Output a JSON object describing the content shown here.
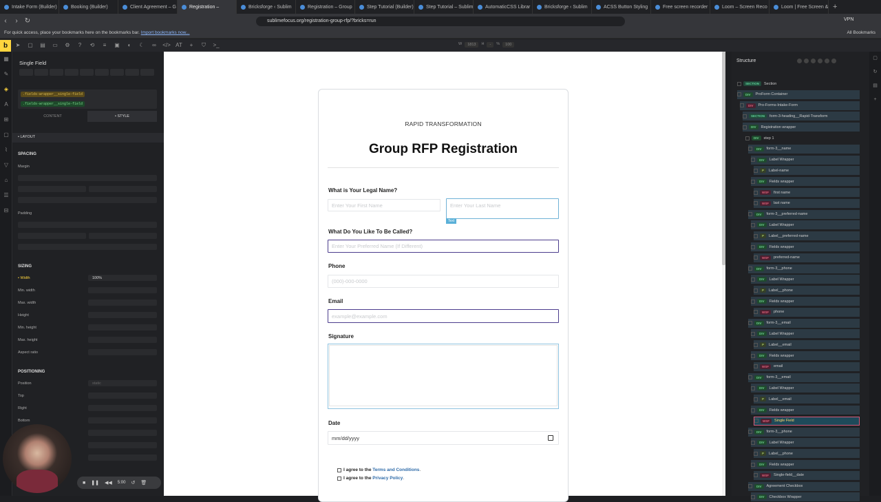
{
  "browser": {
    "tabs": [
      {
        "label": "Intake Form (Builder)",
        "active": false
      },
      {
        "label": "Booking (Builder)",
        "active": false
      },
      {
        "label": "Client Agreement – G",
        "active": false
      },
      {
        "label": "Registration –",
        "active": true
      },
      {
        "label": "Bricksforge ‹ Sublim",
        "active": false
      },
      {
        "label": "Registration – Group",
        "active": false
      },
      {
        "label": "Step Tutorial (Builder)",
        "active": false
      },
      {
        "label": "Step Tutorial – Sublim",
        "active": false
      },
      {
        "label": "AutomaticCSS Librar",
        "active": false
      },
      {
        "label": "Bricksforge ‹ Sublim",
        "active": false
      },
      {
        "label": "ACSS Button Styling",
        "active": false
      },
      {
        "label": "Free screen recorder",
        "active": false
      },
      {
        "label": "Loom – Screen Reco",
        "active": false
      },
      {
        "label": "Loom | Free Screen &",
        "active": false
      }
    ],
    "new_tab": "+",
    "url": "sublimefocus.org/registration-group-rfp/?bricks=run",
    "vpn": "VPN",
    "bookmarks_text": "For quick access, place your bookmarks here on the bookmarks bar.",
    "bookmarks_link": "Import bookmarks now...",
    "all_bookmarks": "All Bookmarks"
  },
  "builder": {
    "logo": "b",
    "toolbar_text_at": "AT",
    "dims": {
      "w_label": "W",
      "w_value": "1813",
      "h_label": "H",
      "h_value": "-",
      "pct_label": "%",
      "pct_value": "100"
    }
  },
  "panel": {
    "title": "Single Field",
    "class1": ".fields-wrapper__single-field",
    "class2": ".fields-wrapper__single-field",
    "tab_content": "CONTENT",
    "tab_style": "• STYLE",
    "layout": "• LAYOUT",
    "spacing": "SPACING",
    "margin": "Margin",
    "padding": "Padding",
    "sizing": "SIZING",
    "width_label": "• Width",
    "width_value": "100%",
    "min_width": "Min. width",
    "max_width": "Max. width",
    "height": "Height",
    "min_height": "Min. height",
    "max_height": "Max. height",
    "aspect_ratio": "Aspect ratio",
    "positioning": "POSITIONING",
    "position": "Position",
    "position_value": "static",
    "top": "Top",
    "right": "Right",
    "bottom": "Bottom"
  },
  "form": {
    "eyebrow": "RAPID TRANSFORMATION",
    "title": "Group RFP Registration",
    "q_name": "What is Your Legal Name?",
    "first_placeholder": "Enter Your First Name",
    "last_placeholder": "Enter Your Last Name",
    "text_tag": "Text",
    "q_called": "What Do You Like To Be Called?",
    "preferred_placeholder": "Enter Your Preferred Name (If Different)",
    "q_phone": "Phone",
    "phone_placeholder": "(000)-000-0000",
    "q_email": "Email",
    "email_placeholder": "example@example.com",
    "q_signature": "Signature",
    "q_date": "Date",
    "date_placeholder": "mm/dd/yyyy",
    "agree_prefix": "I agree to the",
    "terms": "Terms and Conditions",
    "privacy": "Privacy Policy"
  },
  "structure": {
    "title": "Structure",
    "rows": [
      {
        "tag": "SECTION",
        "label": "Section",
        "indent": 2,
        "style": "section"
      },
      {
        "tag": "DIV",
        "label": "ProForm Container",
        "indent": 2,
        "style": "div",
        "hl": true
      },
      {
        "tag": "DIV",
        "label": "Pro-Forms-Intake-Form",
        "indent": 3,
        "style": "wsf",
        "hl": true
      },
      {
        "tag": "SECTION",
        "label": "form-3-heading__Rapid-Transform",
        "indent": 4,
        "style": "section",
        "hl": true
      },
      {
        "tag": "DIV",
        "label": "Registration wrapper",
        "indent": 4,
        "style": "div",
        "hl": true
      },
      {
        "tag": "DIV",
        "label": "step 1",
        "indent": 5,
        "style": "div"
      },
      {
        "tag": "DIV",
        "label": "form-3__name",
        "indent": 6,
        "style": "div",
        "hl": true
      },
      {
        "tag": "DIV",
        "label": "Label Wrapper",
        "indent": 7,
        "style": "div",
        "hl": true
      },
      {
        "tag": "P",
        "label": "Label-name",
        "indent": 8,
        "style": "p",
        "hl": true
      },
      {
        "tag": "DIV",
        "label": "Fields wrapper",
        "indent": 7,
        "style": "div",
        "hl": true
      },
      {
        "tag": "WSF",
        "label": "first name",
        "indent": 8,
        "style": "wsf",
        "hl": true
      },
      {
        "tag": "WSF",
        "label": "last name",
        "indent": 8,
        "style": "wsf",
        "hl": true
      },
      {
        "tag": "DIV",
        "label": "form-3__preferred-name",
        "indent": 6,
        "style": "div",
        "hl": true
      },
      {
        "tag": "DIV",
        "label": "Label Wrapper",
        "indent": 7,
        "style": "div",
        "hl": true
      },
      {
        "tag": "P",
        "label": "Label__preferred-name",
        "indent": 8,
        "style": "p",
        "hl": true
      },
      {
        "tag": "DIV",
        "label": "Fields wrapper",
        "indent": 7,
        "style": "div",
        "hl": true
      },
      {
        "tag": "WSF",
        "label": "preferred-name",
        "indent": 8,
        "style": "wsf",
        "hl": true
      },
      {
        "tag": "DIV",
        "label": "form-3__phone",
        "indent": 6,
        "style": "div",
        "hl": true
      },
      {
        "tag": "DIV",
        "label": "Label Wrapper",
        "indent": 7,
        "style": "div",
        "hl": true
      },
      {
        "tag": "P",
        "label": "Label__phone",
        "indent": 8,
        "style": "p",
        "hl": true
      },
      {
        "tag": "DIV",
        "label": "Fields wrapper",
        "indent": 7,
        "style": "div",
        "hl": true
      },
      {
        "tag": "WSF",
        "label": "phone",
        "indent": 8,
        "style": "wsf",
        "hl": true
      },
      {
        "tag": "DIV",
        "label": "form-3__email",
        "indent": 6,
        "style": "div",
        "hl": true
      },
      {
        "tag": "DIV",
        "label": "Label Wrapper",
        "indent": 7,
        "style": "div",
        "hl": true
      },
      {
        "tag": "P",
        "label": "Label__email",
        "indent": 8,
        "style": "p",
        "hl": true
      },
      {
        "tag": "DIV",
        "label": "Fields wrapper",
        "indent": 7,
        "style": "div",
        "hl": true
      },
      {
        "tag": "WSF",
        "label": "email",
        "indent": 8,
        "style": "wsf",
        "hl": true
      },
      {
        "tag": "DIV",
        "label": "form-3__email",
        "indent": 6,
        "style": "div",
        "hl": true
      },
      {
        "tag": "DIV",
        "label": "Label Wrapper",
        "indent": 7,
        "style": "div",
        "hl": true
      },
      {
        "tag": "P",
        "label": "Label__email",
        "indent": 8,
        "style": "p",
        "hl": true
      },
      {
        "tag": "DIV",
        "label": "Fields wrapper",
        "indent": 7,
        "style": "div",
        "hl": true
      },
      {
        "tag": "WSF",
        "label": "Single Field",
        "indent": 8,
        "style": "wsf",
        "selected": true
      },
      {
        "tag": "DIV",
        "label": "form-3__phone",
        "indent": 6,
        "style": "div",
        "hl": true
      },
      {
        "tag": "DIV",
        "label": "Label Wrapper",
        "indent": 7,
        "style": "div",
        "hl": true
      },
      {
        "tag": "P",
        "label": "Label__phone",
        "indent": 8,
        "style": "p",
        "hl": true
      },
      {
        "tag": "DIV",
        "label": "Fields wrapper",
        "indent": 7,
        "style": "div",
        "hl": true
      },
      {
        "tag": "WSF",
        "label": "Single-field__date",
        "indent": 8,
        "style": "wsf",
        "hl": true
      },
      {
        "tag": "DIV",
        "label": "Agreement Checkbox",
        "indent": 6,
        "style": "div",
        "hl": true
      },
      {
        "tag": "DIV",
        "label": "Checkbox Wrapper",
        "indent": 7,
        "style": "div",
        "hl": true
      }
    ]
  },
  "recorder": {
    "time": "5:00"
  },
  "colors": {
    "brand": "#ffd53e",
    "focus_border": "#4a3b8c",
    "select_border": "#6fb1d6",
    "link": "#2d6aa8"
  }
}
